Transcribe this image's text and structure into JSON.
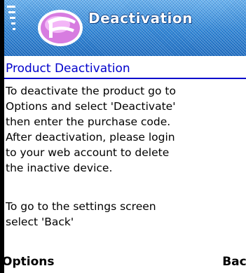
{
  "title_bar": {
    "title": "Deactivation",
    "logo_icon": "app-logo-icon",
    "signal_icon": "signal-strength-icon"
  },
  "content": {
    "heading": "Product Deactivation",
    "paragraph1_lines": [
      "To deactivate the product go to",
      "Options and select 'Deactivate'",
      "then enter the purchase code.",
      "After deactivation, please login",
      "to your web account to delete",
      "the inactive device."
    ],
    "paragraph2_lines": [
      "To go to the settings screen",
      "select 'Back'"
    ]
  },
  "softkeys": {
    "left": "Options",
    "right": "Back"
  },
  "colors": {
    "title_bar": "#3a8fd8",
    "heading": "#0000cc",
    "content_bg": "#ffffff",
    "text": "#000000"
  }
}
